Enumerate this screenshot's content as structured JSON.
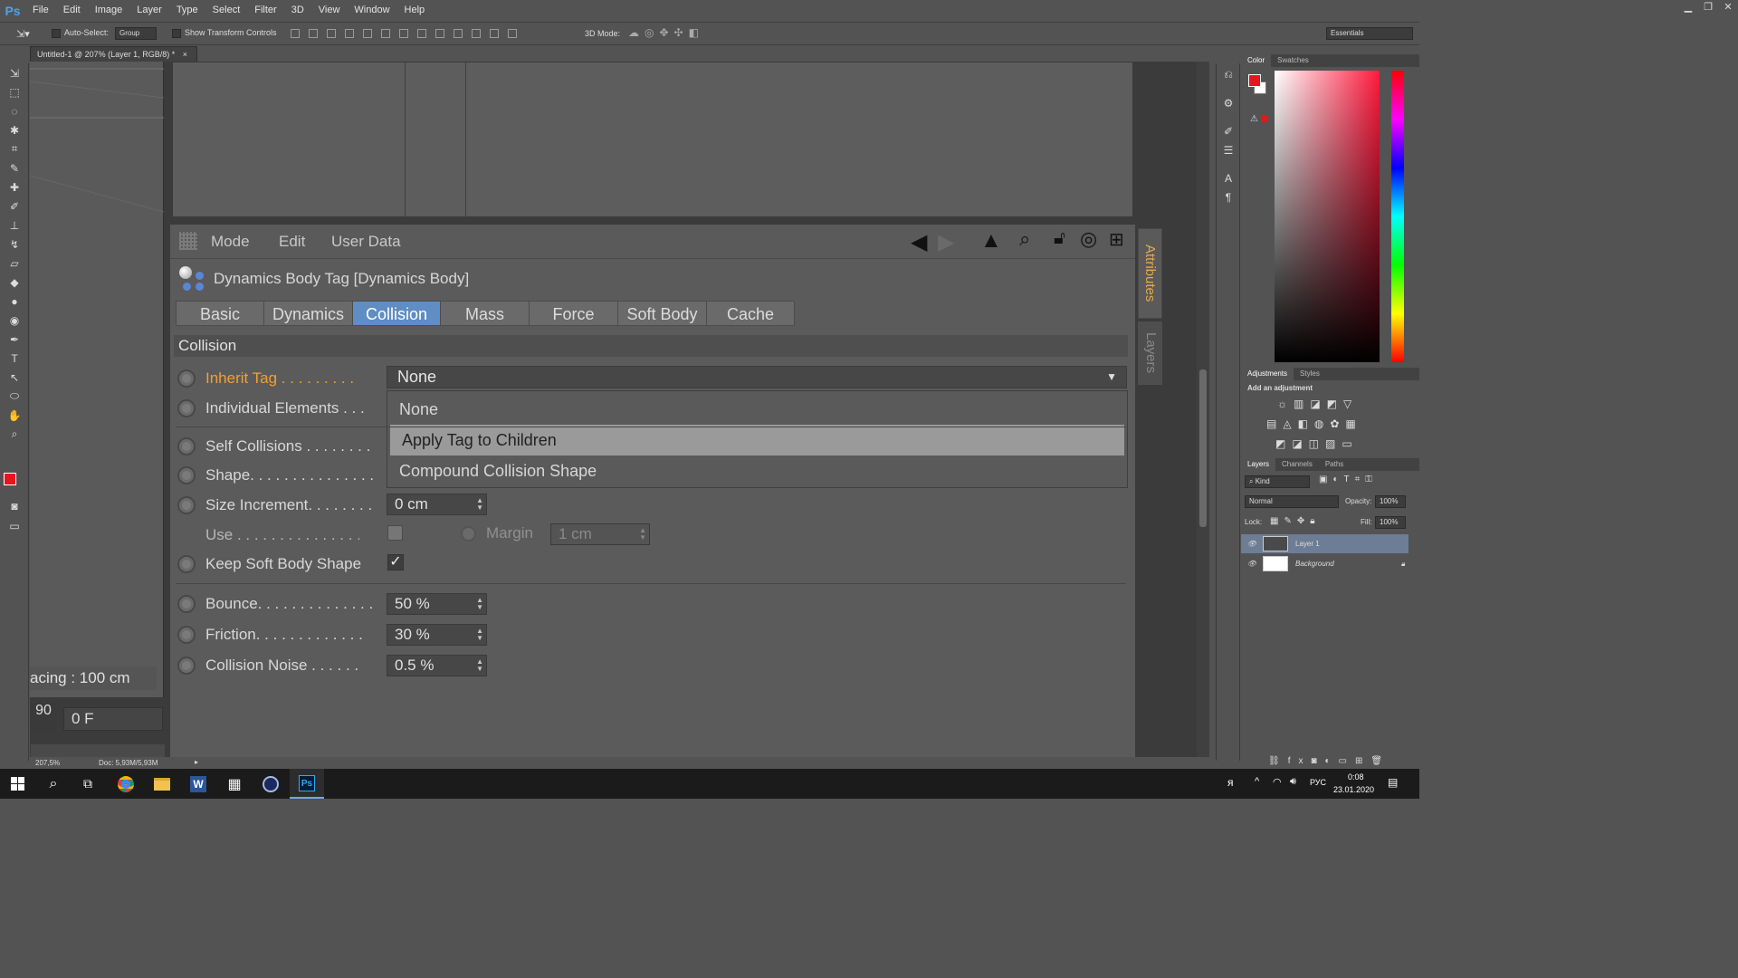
{
  "app": {
    "logo": "Ps",
    "menu": [
      "File",
      "Edit",
      "Image",
      "Layer",
      "Type",
      "Select",
      "Filter",
      "3D",
      "View",
      "Window",
      "Help"
    ]
  },
  "window_controls": {
    "minimize": "▁",
    "restore": "❐",
    "close": "✕"
  },
  "options": {
    "auto_select_label": "Auto-Select:",
    "auto_select_value": "Group",
    "show_transform": "Show Transform Controls",
    "mode_3d": "3D Mode:",
    "workspace": "Essentials"
  },
  "document": {
    "tab_title": "Untitled-1 @ 207% (Layer 1, RGB/8) *",
    "tab_close": "×"
  },
  "canvas": {
    "spacing_text": "acing : 100 cm",
    "frame_left": "90",
    "frame_value": "0 F"
  },
  "attributes": {
    "menu": [
      "Mode",
      "Edit",
      "User Data"
    ],
    "tag_title": "Dynamics Body Tag [Dynamics Body]",
    "tabs": [
      "Basic",
      "Dynamics",
      "Collision",
      "Mass",
      "Force",
      "Soft Body",
      "Cache"
    ],
    "active_tab": "Collision",
    "section": "Collision",
    "inherit_tag": {
      "label": "Inherit Tag . . . . . . . . .",
      "value": "None"
    },
    "dropdown_options": [
      "None",
      "Apply Tag to Children",
      "Compound Collision Shape"
    ],
    "individual_elements": {
      "label": "Individual Elements . . ."
    },
    "self_collisions": {
      "label": "Self Collisions . . . . . . . ."
    },
    "shape": {
      "label": "Shape. . . . . . . . . . . . . . ."
    },
    "size_increment": {
      "label": "Size Increment. . . . . . . .",
      "value": "0 cm"
    },
    "use": {
      "label": "Use . . . . . . . . . . . . . . . . ."
    },
    "margin": {
      "label": "Margin",
      "value": "1 cm"
    },
    "keep_soft_body": {
      "label": "Keep Soft Body Shape",
      "check": "✓"
    },
    "bounce": {
      "label": "Bounce. . . . . . . . . . . . . .",
      "value": "50 %"
    },
    "friction": {
      "label": "Friction. . . . . . . . . . . . .",
      "value": "30 %"
    },
    "collision_noise": {
      "label": "Collision Noise . . . . . .",
      "value": "0.5 %"
    },
    "side_tabs": [
      "Attributes",
      "Layers"
    ]
  },
  "panels": {
    "color_tabs": [
      "Color",
      "Swatches"
    ],
    "adjust_tabs": [
      "Adjustments",
      "Styles"
    ],
    "add_adjustment": "Add an adjustment",
    "layers_tabs": [
      "Layers",
      "Channels",
      "Paths"
    ],
    "kind": "Kind",
    "blend_mode": "Normal",
    "opacity_label": "Opacity:",
    "opacity_value": "100%",
    "lock_label": "Lock:",
    "fill_label": "Fill:",
    "fill_value": "100%",
    "layers": [
      "Layer 1",
      "Background"
    ]
  },
  "status": {
    "zoom": "207,5%",
    "doc": "Doc: 5,93M/5,93M"
  },
  "taskbar": {
    "lang": "РУС",
    "time": "0:08",
    "date": "23.01.2020"
  },
  "colors": {
    "accent_tab": "#5f8dc4",
    "highlight_label": "#f0a030",
    "foreground": "#e8141e",
    "attributes_tab": "#e3a94b"
  }
}
